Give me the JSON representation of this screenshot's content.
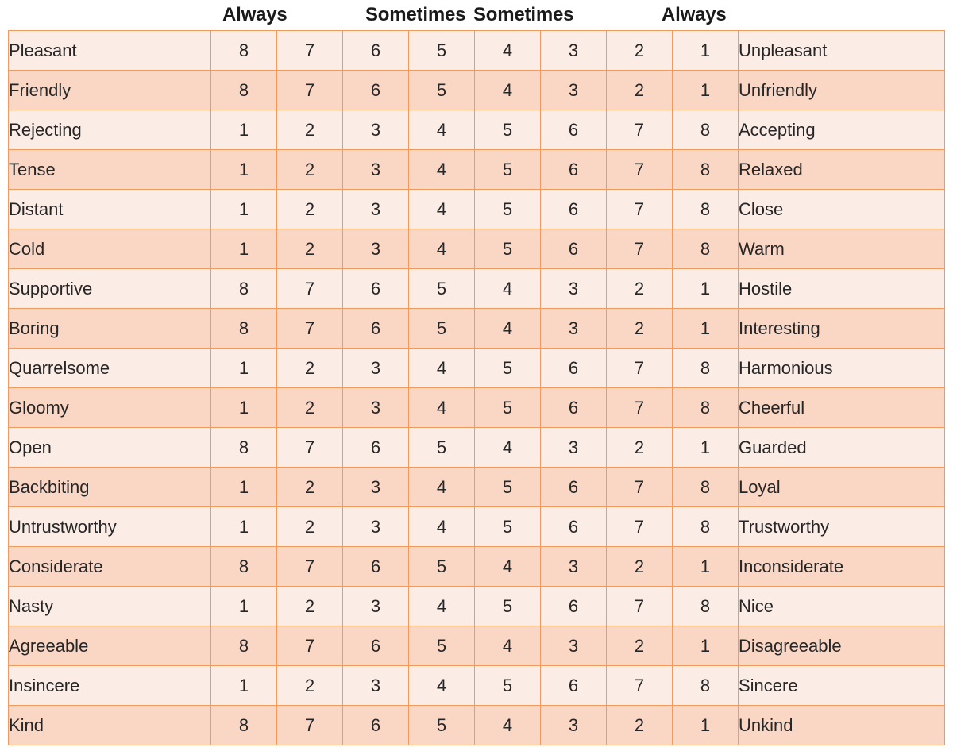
{
  "header": {
    "labels": [
      {
        "text": "Always",
        "name": "header-always-left"
      },
      {
        "text": "Sometimes",
        "name": "header-sometimes-left"
      },
      {
        "text": "Sometimes",
        "name": "header-sometimes-right"
      },
      {
        "text": "Always",
        "name": "header-always-right"
      }
    ]
  },
  "colors": {
    "row_light": "#fcece6",
    "row_dark": "#fad6c5",
    "grid_line": "#ef9a5e",
    "table_border": "#e8a06a",
    "text": "#262626",
    "background": "#ffffff"
  },
  "chart_data": {
    "type": "table",
    "title": "",
    "columns": [
      "left_pole",
      "8",
      "7",
      "6",
      "5",
      "4",
      "3",
      "2",
      "1",
      "right_pole"
    ],
    "scale_headers": [
      "Always",
      "Sometimes",
      "Sometimes",
      "Always"
    ],
    "rows": [
      {
        "left": "Pleasant",
        "values": [
          "8",
          "7",
          "6",
          "5",
          "4",
          "3",
          "2",
          "1"
        ],
        "right": "Unpleasant"
      },
      {
        "left": "Friendly",
        "values": [
          "8",
          "7",
          "6",
          "5",
          "4",
          "3",
          "2",
          "1"
        ],
        "right": "Unfriendly"
      },
      {
        "left": "Rejecting",
        "values": [
          "1",
          "2",
          "3",
          "4",
          "5",
          "6",
          "7",
          "8"
        ],
        "right": "Accepting"
      },
      {
        "left": "Tense",
        "values": [
          "1",
          "2",
          "3",
          "4",
          "5",
          "6",
          "7",
          "8"
        ],
        "right": "Relaxed"
      },
      {
        "left": "Distant",
        "values": [
          "1",
          "2",
          "3",
          "4",
          "5",
          "6",
          "7",
          "8"
        ],
        "right": "Close"
      },
      {
        "left": "Cold",
        "values": [
          "1",
          "2",
          "3",
          "4",
          "5",
          "6",
          "7",
          "8"
        ],
        "right": "Warm"
      },
      {
        "left": "Supportive",
        "values": [
          "8",
          "7",
          "6",
          "5",
          "4",
          "3",
          "2",
          "1"
        ],
        "right": "Hostile"
      },
      {
        "left": "Boring",
        "values": [
          "8",
          "7",
          "6",
          "5",
          "4",
          "3",
          "2",
          "1"
        ],
        "right": "Interesting"
      },
      {
        "left": "Quarrelsome",
        "values": [
          "1",
          "2",
          "3",
          "4",
          "5",
          "6",
          "7",
          "8"
        ],
        "right": "Harmonious"
      },
      {
        "left": "Gloomy",
        "values": [
          "1",
          "2",
          "3",
          "4",
          "5",
          "6",
          "7",
          "8"
        ],
        "right": "Cheerful"
      },
      {
        "left": "Open",
        "values": [
          "8",
          "7",
          "6",
          "5",
          "4",
          "3",
          "2",
          "1"
        ],
        "right": "Guarded"
      },
      {
        "left": "Backbiting",
        "values": [
          "1",
          "2",
          "3",
          "4",
          "5",
          "6",
          "7",
          "8"
        ],
        "right": "Loyal"
      },
      {
        "left": "Untrustworthy",
        "values": [
          "1",
          "2",
          "3",
          "4",
          "5",
          "6",
          "7",
          "8"
        ],
        "right": "Trustworthy"
      },
      {
        "left": "Considerate",
        "values": [
          "8",
          "7",
          "6",
          "5",
          "4",
          "3",
          "2",
          "1"
        ],
        "right": "Inconsiderate"
      },
      {
        "left": "Nasty",
        "values": [
          "1",
          "2",
          "3",
          "4",
          "5",
          "6",
          "7",
          "8"
        ],
        "right": "Nice"
      },
      {
        "left": "Agreeable",
        "values": [
          "8",
          "7",
          "6",
          "5",
          "4",
          "3",
          "2",
          "1"
        ],
        "right": "Disagreeable"
      },
      {
        "left": "Insincere",
        "values": [
          "1",
          "2",
          "3",
          "4",
          "5",
          "6",
          "7",
          "8"
        ],
        "right": "Sincere"
      },
      {
        "left": "Kind",
        "values": [
          "8",
          "7",
          "6",
          "5",
          "4",
          "3",
          "2",
          "1"
        ],
        "right": "Unkind"
      }
    ]
  }
}
